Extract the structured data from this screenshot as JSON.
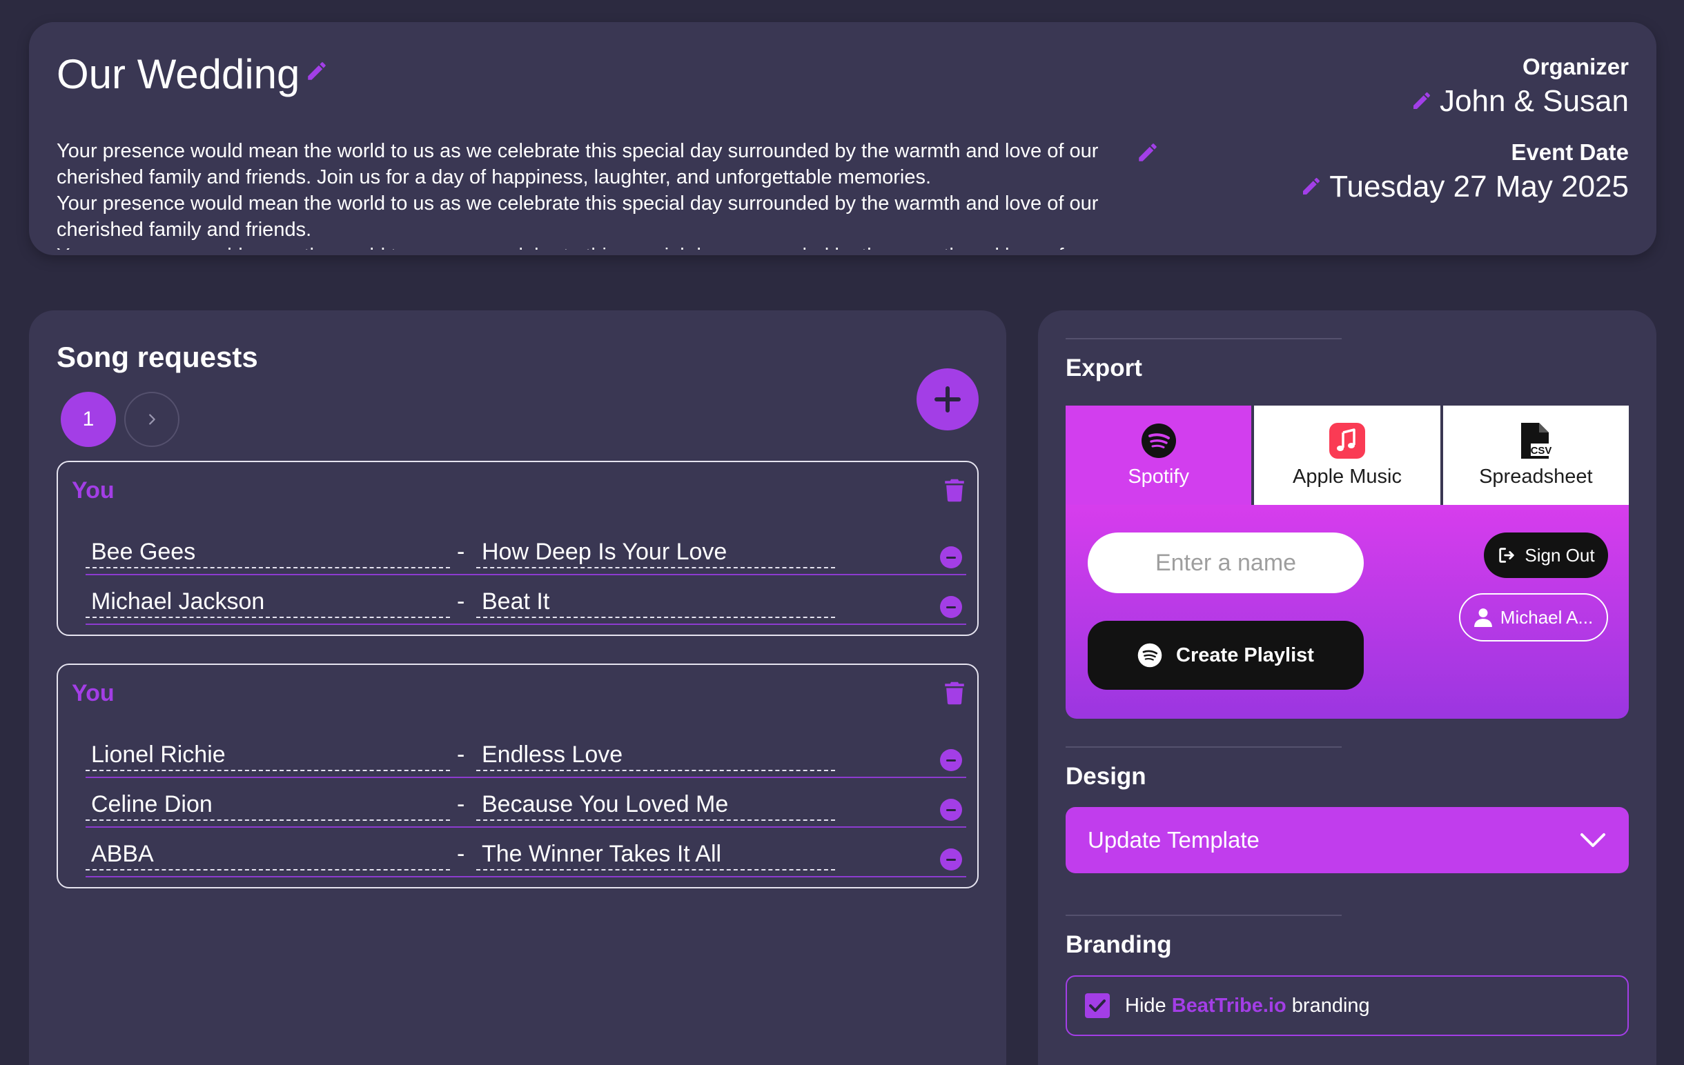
{
  "event": {
    "title": "Our Wedding",
    "description_lines": [
      "Your presence would mean the world to us as we celebrate this special day surrounded by the warmth and love of our cherished family and friends. Join us for a day of happiness, laughter, and unforgettable memories.",
      "Your presence would mean the world to us as we celebrate this special day surrounded by the warmth and love of our cherished family and friends.",
      "Your presence would mean the world to us as we celebrate this special day surrounded by the warmth and love of our cherished family and friends."
    ],
    "organizer_label": "Organizer",
    "organizer_value": "John & Susan",
    "date_label": "Event Date",
    "date_value": "Tuesday 27 May 2025"
  },
  "songs": {
    "title": "Song requests",
    "pagination": {
      "current_page": "1",
      "next_icon": "chevron-right-icon"
    },
    "add_icon": "plus-icon",
    "requests": [
      {
        "requester": "You",
        "songs": [
          {
            "artist": "Bee Gees",
            "separator": "-",
            "track": "How Deep Is Your Love"
          },
          {
            "artist": "Michael Jackson",
            "separator": "-",
            "track": "Beat It"
          }
        ]
      },
      {
        "requester": "You",
        "songs": [
          {
            "artist": "Lionel Richie",
            "separator": "-",
            "track": "Endless Love"
          },
          {
            "artist": "Celine Dion",
            "separator": "-",
            "track": "Because You Loved Me"
          },
          {
            "artist": "ABBA",
            "separator": "-",
            "track": "The Winner Takes It All"
          }
        ]
      }
    ]
  },
  "export": {
    "title": "Export",
    "tabs": [
      {
        "label": "Spotify",
        "icon": "spotify-icon",
        "active": true
      },
      {
        "label": "Apple Music",
        "icon": "apple-music-icon",
        "active": false
      },
      {
        "label": "Spreadsheet",
        "icon": "csv-file-icon",
        "active": false
      }
    ],
    "name_placeholder": "Enter a name",
    "create_label": "Create Playlist",
    "signout_label": "Sign Out",
    "user_label": "Michael A..."
  },
  "design": {
    "title": "Design",
    "template_label": "Update Template"
  },
  "branding": {
    "title": "Branding",
    "prefix": "Hide",
    "brand": "BeatTribe.io",
    "suffix": "branding",
    "checked": true
  },
  "colors": {
    "background": "#2c2a40",
    "card": "#3a3753",
    "accent": "#a33ee6",
    "export_gradient_top": "#d73ded",
    "export_gradient_bottom": "#9b36e0"
  }
}
